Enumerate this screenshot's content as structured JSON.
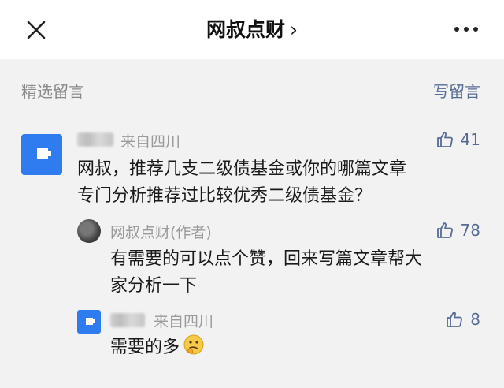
{
  "header": {
    "title": "网叔点财",
    "chevron": "›"
  },
  "section": {
    "title": "精选留言",
    "write_label": "写留言"
  },
  "comments": [
    {
      "location": "来自四川",
      "likes": "41",
      "text_line1": "网叔，推荐几支二级债基金或你的哪篇文章",
      "text_line2": "专门分析推荐过比较优秀二级债基金？"
    }
  ],
  "reply": {
    "author": "网叔点财(作者)",
    "likes": "78",
    "text_line1": "有需要的可以点个赞，回来写篇文章帮大",
    "text_line2": "家分析一下"
  },
  "sub_comment": {
    "location": "来自四川",
    "likes": "8",
    "text": "需要的多"
  },
  "colors": {
    "link": "#576b95",
    "avatar_blue": "#2f7bf0",
    "background": "#f2f2f2"
  }
}
